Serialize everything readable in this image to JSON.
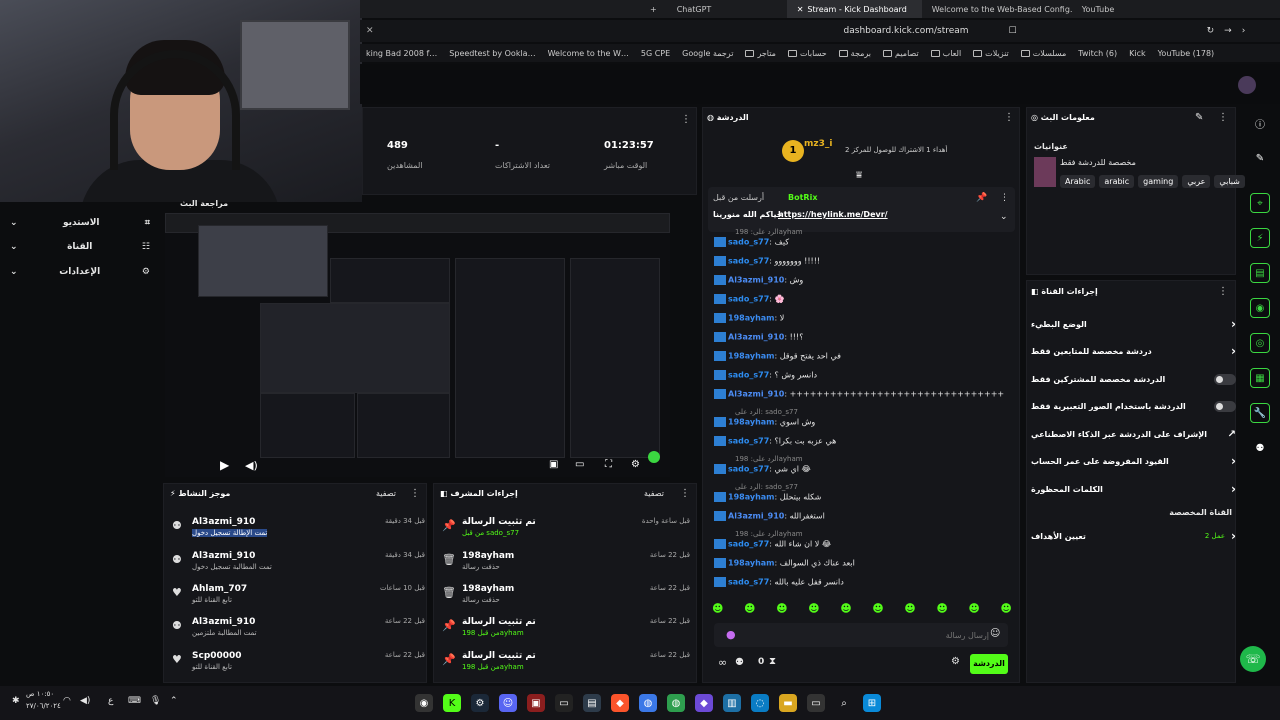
{
  "browser": {
    "tabs": [
      "ChatGPT",
      "Stream - Kick Dashboard",
      "Welcome to the Web-Based Config…",
      "YouTube"
    ],
    "add_tab": "+",
    "url": "dashboard.kick.com/stream",
    "bookmarks": [
      "king Bad 2008 f…",
      "Speedtest by Ookla…",
      "Welcome to the W…",
      "5G CPE",
      "Google ترجمة",
      "متاجر",
      "حسابات",
      "برمجة",
      "تصاميم",
      "العاب",
      "تنزيلات",
      "مسلسلات",
      "Twitch (6)",
      "Kick",
      "YouTube (178)"
    ]
  },
  "nav": {
    "items": [
      {
        "label": "الاستديو",
        "icon": "studio-icon"
      },
      {
        "label": "القناة",
        "icon": "channel-icon"
      },
      {
        "label": "الإعدادات",
        "icon": "gear-icon"
      }
    ]
  },
  "stats": [
    {
      "value": "489",
      "label": "المشاهدين"
    },
    {
      "value": "-",
      "label": "تعداد الاشتراكات"
    },
    {
      "value": "01:23:57",
      "label": "الوقت مباشر"
    }
  ],
  "preview": {
    "title": "مراجعة البث"
  },
  "activity": {
    "title": "موجز النشاط",
    "filter": "تصفية",
    "rows": [
      {
        "name": "Al3azmi_910",
        "sub": "تمت الإطالة تسجيل دخول",
        "time": "قبل 34 دقيقة"
      },
      {
        "name": "Al3azmi_910",
        "sub": "تمت المطالبة تسجيل دخول",
        "time": "قبل 34 دقيقة"
      },
      {
        "name": "Ahlam_707",
        "sub": "تابع القناة للتو",
        "time": "قبل 10 ساعات"
      },
      {
        "name": "Al3azmi_910",
        "sub": "تمت المطالبة ملتزمين",
        "time": "قبل 22 ساعة"
      },
      {
        "name": "Scp00000",
        "sub": "تابع القناة للتو",
        "time": "قبل 22 ساعة"
      }
    ]
  },
  "modactions": {
    "title": "إجراءات المشرف",
    "filter": "تصفية",
    "rows": [
      {
        "name": "تم تثبيت الرسالة",
        "sub": "من قبل sado_s77",
        "time": "قبل ساعة واحدة"
      },
      {
        "name": "198ayham",
        "sub": "حذفت رسالة",
        "time": "قبل 22 ساعة"
      },
      {
        "name": "198ayham",
        "sub": "حذفت رسالة",
        "time": "قبل 22 ساعة"
      },
      {
        "name": "تم تثبيت الرسالة",
        "sub": "من قبل 198ayham",
        "time": "قبل 22 ساعة"
      },
      {
        "name": "تم تثبيت الرسالة",
        "sub": "من قبل 198ayham",
        "time": "قبل 22 ساعة"
      }
    ]
  },
  "chat": {
    "title": "الدردشة",
    "gift_user": "mz3_i",
    "gift_text": "أهداء 1 الاشتراك للوصول للمركز 2",
    "pinned": {
      "by": "أرسلت من قبل",
      "user": "BotRix",
      "text": "حياكم الله منورينا",
      "link": "https://heylink.me/Devr/"
    },
    "messages": [
      {
        "user": "sado_s77",
        "color": "#2d8cf0",
        "text": "كيف",
        "reply": "الرد على: 198ayham"
      },
      {
        "user": "sado_s77",
        "color": "#2d8cf0",
        "text": "ووووووو !!!!!"
      },
      {
        "user": "Al3azmi_910",
        "color": "#4c8df6",
        "text": "وش"
      },
      {
        "user": "sado_s77",
        "color": "#2d8cf0",
        "text": "🌸"
      },
      {
        "user": "198ayham",
        "color": "#3b8bf0",
        "text": "لا"
      },
      {
        "user": "Al3azmi_910",
        "color": "#4c8df6",
        "text": "!!!؟"
      },
      {
        "user": "198ayham",
        "color": "#3b8bf0",
        "text": "في احد يفتح قوقل"
      },
      {
        "user": "sado_s77",
        "color": "#2d8cf0",
        "text": "دانسر وش ؟"
      },
      {
        "user": "Al3azmi_910",
        "color": "#4c8df6",
        "text": "++++++++++++++++++++++++++++++++"
      },
      {
        "user": "198ayham",
        "color": "#3b8bf0",
        "text": "وش اسوي",
        "reply": "الرد على: sado_s77"
      },
      {
        "user": "sado_s77",
        "color": "#2d8cf0",
        "text": "هي عزبه بت بكرا؟"
      },
      {
        "user": "sado_s77",
        "color": "#2d8cf0",
        "text": "اي شي 😂",
        "reply": "الرد على: 198ayham"
      },
      {
        "user": "198ayham",
        "color": "#3b8bf0",
        "text": "شكله بيتحلل",
        "reply": "الرد على: sado_s77"
      },
      {
        "user": "Al3azmi_910",
        "color": "#4c8df6",
        "text": "استغفرالله"
      },
      {
        "user": "sado_s77",
        "color": "#2d8cf0",
        "text": "لا ان شاء الله 😂",
        "reply": "الرد على: 198ayham"
      },
      {
        "user": "198ayham",
        "color": "#3b8bf0",
        "text": "ابعد عناك ذي السوالف"
      },
      {
        "user": "sado_s77",
        "color": "#2d8cf0",
        "text": "دانسر قفل عليه بالله"
      }
    ],
    "input_placeholder": "إرسال رسالة",
    "send_label": "الدردشة",
    "count": "0"
  },
  "streaminfo": {
    "title": "معلومات البث",
    "headline": "عنوانيات",
    "desc": "مخصصة للدردشة فقط",
    "tags": [
      "Arabic",
      "arabic",
      "gaming",
      "عربي",
      "شبابي"
    ]
  },
  "channelactions": {
    "title": "إجراءات القناة",
    "rows": [
      {
        "label": "الوضع البطيء",
        "control": "chevron"
      },
      {
        "label": "دردشة مخصصة للمتابعين فقط",
        "control": "chevron"
      },
      {
        "label": "الدردشة مخصصة للمشتركين فقط",
        "control": "toggle"
      },
      {
        "label": "الدردشة باستخدام الصور التعبيرية فقط",
        "control": "toggle"
      },
      {
        "label": "الإشراف على الدردشة عبر الذكاء الاصطناعي",
        "control": "external"
      },
      {
        "label": "القيود المفروضة على عمر الحساب",
        "control": "chevron"
      },
      {
        "label": "الكلمات المحظورة",
        "control": "chevron"
      }
    ],
    "section": "القناة المخصصة",
    "goals_label": "تعيين الأهداف",
    "goals_count": "عمل 2"
  },
  "taskbar": {
    "time": "١٠:٥٠ ص",
    "date": "٢٧/٠٦/٢٠٢٤",
    "lang": "ع"
  },
  "colors": {
    "accent": "#53fc18",
    "bg": "#0c0d0f",
    "panel": "#15161a"
  }
}
